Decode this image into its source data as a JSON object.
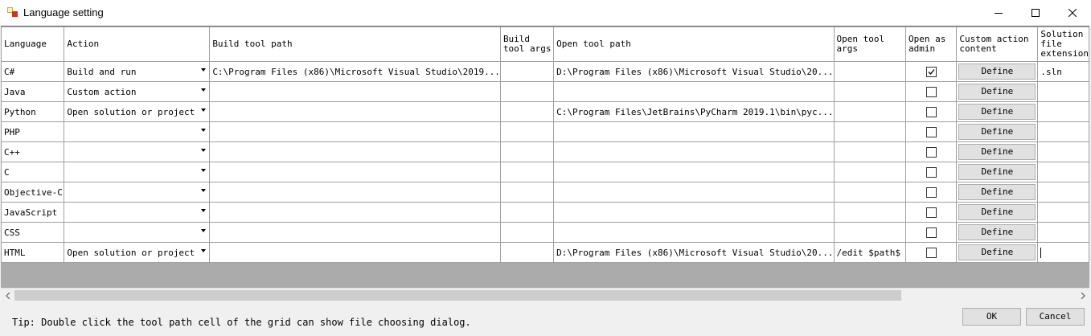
{
  "window": {
    "title": "Language setting",
    "icons": {
      "app": "app-icon",
      "minimize": "minimize-icon",
      "maximize": "maximize-icon",
      "close": "close-icon"
    }
  },
  "grid": {
    "columns": [
      "Language",
      "Action",
      "Build tool path",
      "Build tool args",
      "Open tool path",
      "Open tool args",
      "Open as admin",
      "Custom action content",
      "Solution file extension"
    ],
    "define_label": "Define",
    "rows": [
      {
        "language": "C#",
        "action": "Build and run",
        "build_path": "C:\\Program Files (x86)\\Microsoft Visual Studio\\2019...",
        "build_args": "",
        "open_path": "D:\\Program Files (x86)\\Microsoft Visual Studio\\20...",
        "open_args": "",
        "admin": true,
        "ext": ".sln"
      },
      {
        "language": "Java",
        "action": "Custom action",
        "build_path": "",
        "build_args": "",
        "open_path": "",
        "open_args": "",
        "admin": false,
        "ext": ""
      },
      {
        "language": "Python",
        "action": "Open solution or project",
        "build_path": "",
        "build_args": "",
        "open_path": "C:\\Program Files\\JetBrains\\PyCharm 2019.1\\bin\\pyc...",
        "open_args": "",
        "admin": false,
        "ext": ""
      },
      {
        "language": "PHP",
        "action": "",
        "build_path": "",
        "build_args": "",
        "open_path": "",
        "open_args": "",
        "admin": false,
        "ext": ""
      },
      {
        "language": "C++",
        "action": "",
        "build_path": "",
        "build_args": "",
        "open_path": "",
        "open_args": "",
        "admin": false,
        "ext": ""
      },
      {
        "language": "C",
        "action": "",
        "build_path": "",
        "build_args": "",
        "open_path": "",
        "open_args": "",
        "admin": false,
        "ext": ""
      },
      {
        "language": "Objective-C",
        "action": "",
        "build_path": "",
        "build_args": "",
        "open_path": "",
        "open_args": "",
        "admin": false,
        "ext": ""
      },
      {
        "language": "JavaScript",
        "action": "",
        "build_path": "",
        "build_args": "",
        "open_path": "",
        "open_args": "",
        "admin": false,
        "ext": ""
      },
      {
        "language": "CSS",
        "action": "",
        "build_path": "",
        "build_args": "",
        "open_path": "",
        "open_args": "",
        "admin": false,
        "ext": ""
      },
      {
        "language": "HTML",
        "action": "Open solution or project",
        "build_path": "",
        "build_args": "",
        "open_path": "D:\\Program Files (x86)\\Microsoft Visual Studio\\20...",
        "open_args": "/edit $path$",
        "admin": false,
        "ext": ""
      }
    ]
  },
  "scrollbar": {
    "left_icon": "scroll-left-icon",
    "right_icon": "scroll-right-icon"
  },
  "footer": {
    "tip": "Tip: Double click the tool path cell of the grid can show file choosing dialog.",
    "ok_label": "OK",
    "cancel_label": "Cancel"
  }
}
